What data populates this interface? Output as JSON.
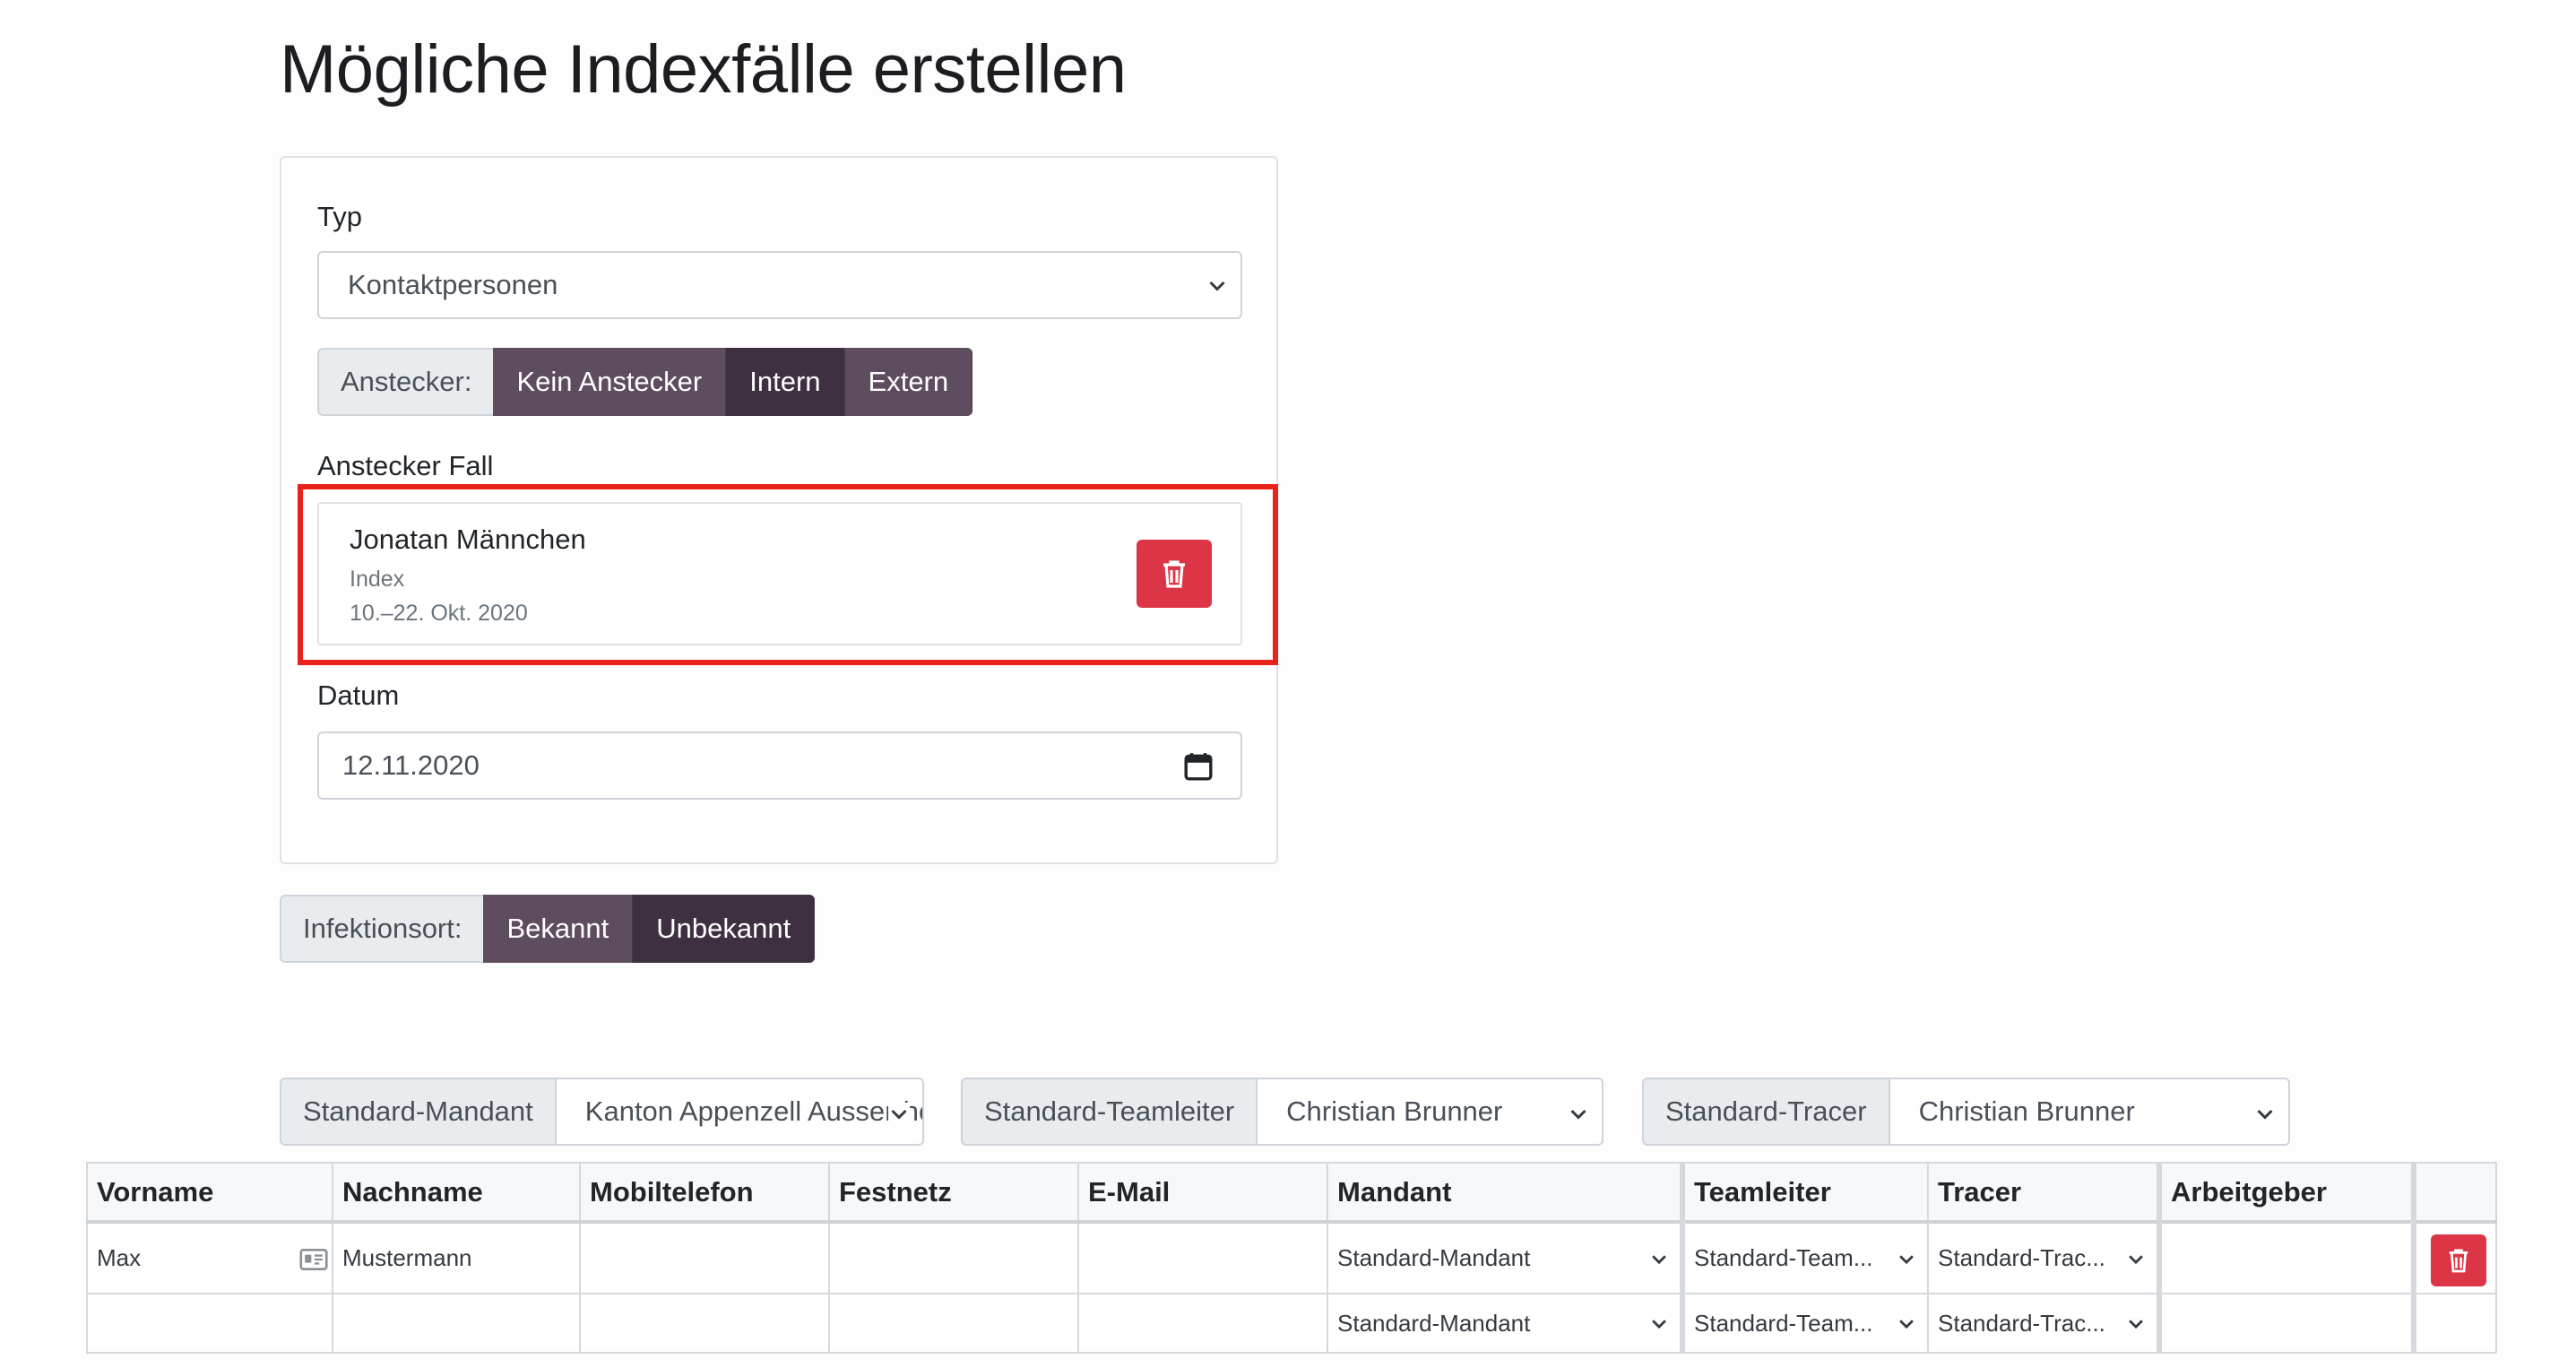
{
  "page": {
    "title": "Mögliche Indexfälle erstellen"
  },
  "form": {
    "typ_label": "Typ",
    "typ_value": "Kontaktpersonen",
    "anstecker": {
      "prefix": "Anstecker:",
      "options": [
        "Kein Anstecker",
        "Intern",
        "Extern"
      ],
      "selected": "Intern"
    },
    "anstecker_fall_label": "Anstecker Fall",
    "anstecker_fall": {
      "name": "Jonatan Männchen",
      "type": "Index",
      "period": "10.–22. Okt. 2020"
    },
    "datum_label": "Datum",
    "datum_value": "12.11.2020",
    "infektionsort": {
      "prefix": "Infektionsort:",
      "options": [
        "Bekannt",
        "Unbekannt"
      ],
      "selected": "Unbekannt"
    }
  },
  "defaults": {
    "mandant_prefix": "Standard-Mandant",
    "mandant_value": "Kanton Appenzell Ausserrhoden",
    "teamleiter_prefix": "Standard-Teamleiter",
    "teamleiter_value": "Christian Brunner",
    "tracer_prefix": "Standard-Tracer",
    "tracer_value": "Christian Brunner"
  },
  "table": {
    "columns": [
      "Vorname",
      "Nachname",
      "Mobiltelefon",
      "Festnetz",
      "E-Mail",
      "Mandant",
      "Teamleiter",
      "Tracer",
      "Arbeitgeber",
      ""
    ],
    "rows": [
      {
        "vorname": "Max",
        "nachname": "Mustermann",
        "mobil": "",
        "festnetz": "",
        "email": "",
        "mandant": "Standard-Mandant",
        "teamleiter": "Standard-Team...",
        "tracer": "Standard-Trac...",
        "arbeitgeber": ""
      },
      {
        "vorname": "",
        "nachname": "",
        "mobil": "",
        "festnetz": "",
        "email": "",
        "mandant": "Standard-Mandant",
        "teamleiter": "Standard-Team...",
        "tracer": "Standard-Trac...",
        "arbeitgeber": ""
      }
    ]
  },
  "icons": {
    "trash": "trash-icon",
    "calendar": "calendar-icon",
    "contact_card": "id-card-icon",
    "caret": "chevron-down-icon"
  },
  "colors": {
    "danger": "#dc3545",
    "btn_primary": "#5e4d5e",
    "btn_active": "#3e3040",
    "highlight": "#e8231c"
  }
}
